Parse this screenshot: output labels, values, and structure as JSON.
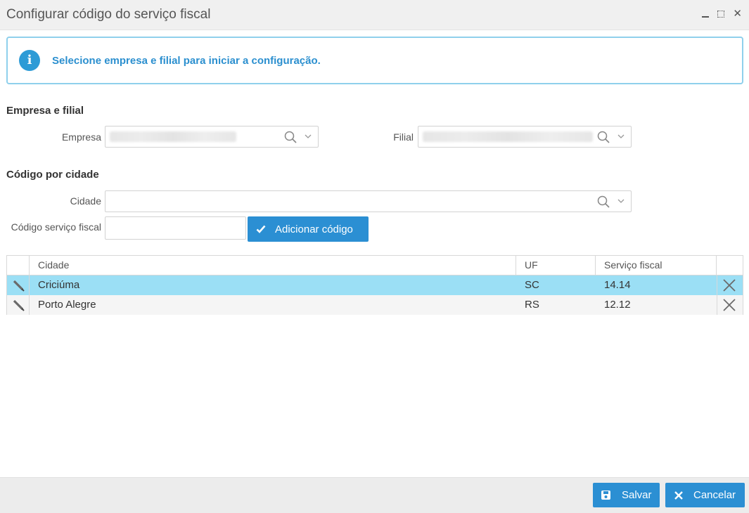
{
  "window": {
    "title": "Configurar código do serviço fiscal"
  },
  "info": {
    "message": "Selecione empresa e filial para iniciar a configuração."
  },
  "company_section": {
    "heading": "Empresa e filial",
    "empresa_label": "Empresa",
    "filial_label": "Filial"
  },
  "city_section": {
    "heading": "Código por cidade",
    "cidade_label": "Cidade",
    "codigo_label": "Código serviço fiscal",
    "codigo_value": "",
    "add_button": "Adicionar código"
  },
  "grid": {
    "headers": {
      "cidade": "Cidade",
      "uf": "UF",
      "servico": "Serviço fiscal"
    },
    "rows": [
      {
        "cidade": "Criciúma",
        "uf": "SC",
        "servico": "14.14",
        "selected": true
      },
      {
        "cidade": "Porto Alegre",
        "uf": "RS",
        "servico": "12.12",
        "selected": false
      }
    ]
  },
  "footer": {
    "save": "Salvar",
    "cancel": "Cancelar"
  },
  "colors": {
    "accent": "#2b8fd3",
    "selected_row": "#9bdff5",
    "info_border": "#8fd0ec"
  }
}
